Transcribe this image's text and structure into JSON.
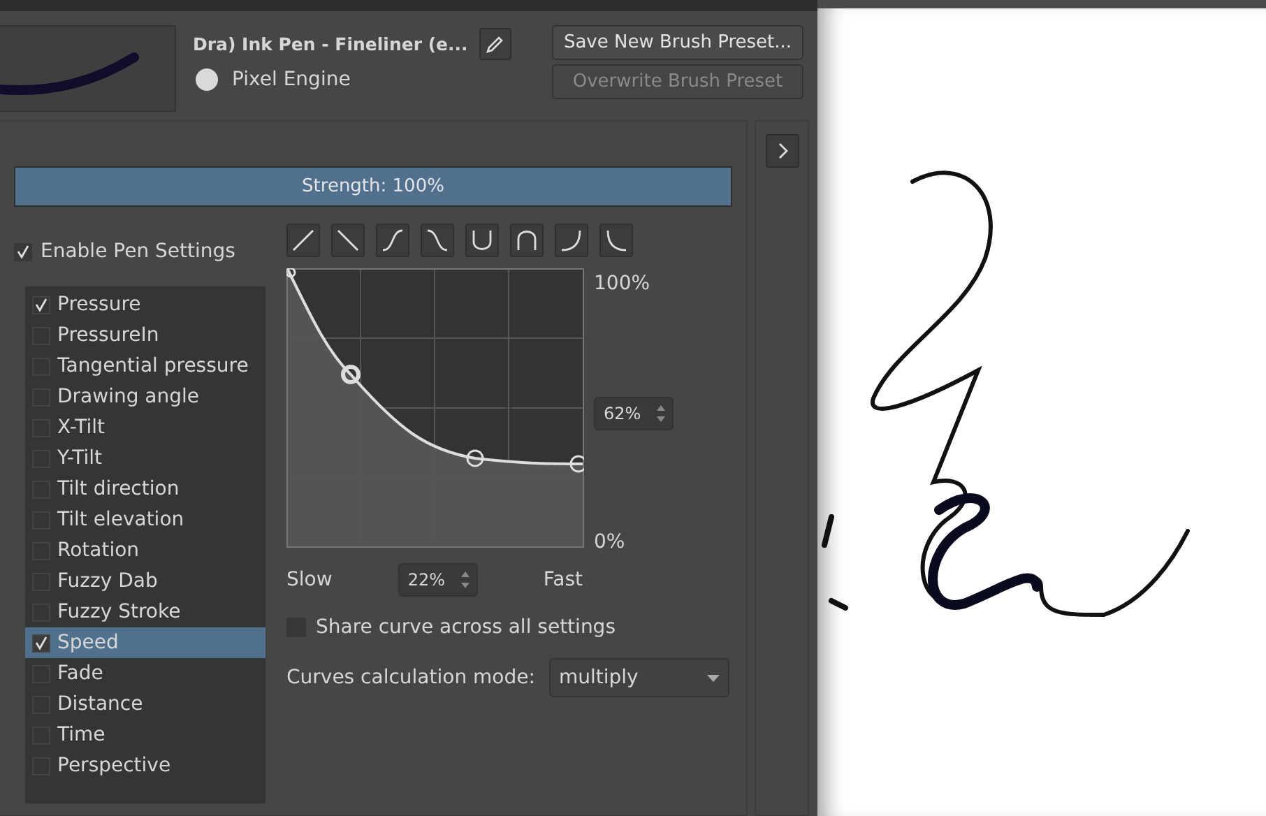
{
  "preset": {
    "name": "Dra) Ink Pen - Fineliner (e...",
    "engine": "Pixel Engine"
  },
  "buttons": [
    {
      "label": "Save New Brush Preset...",
      "disabled": false
    },
    {
      "label": "Overwrite Brush Preset",
      "disabled": true
    }
  ],
  "strength": {
    "label": "Strength: 100%",
    "level": 1
  },
  "enable_pen_settings": {
    "label": "Enable Pen Settings",
    "checked": true
  },
  "sensors": [
    {
      "label": "Pressure",
      "checked": true,
      "selected": false
    },
    {
      "label": "PressureIn",
      "checked": false,
      "selected": false
    },
    {
      "label": "Tangential pressure",
      "checked": false,
      "selected": false
    },
    {
      "label": "Drawing angle",
      "checked": false,
      "selected": false
    },
    {
      "label": "X-Tilt",
      "checked": false,
      "selected": false
    },
    {
      "label": "Y-Tilt",
      "checked": false,
      "selected": false
    },
    {
      "label": "Tilt direction",
      "checked": false,
      "selected": false
    },
    {
      "label": "Tilt elevation",
      "checked": false,
      "selected": false
    },
    {
      "label": "Rotation",
      "checked": false,
      "selected": false
    },
    {
      "label": "Fuzzy Dab",
      "checked": false,
      "selected": false
    },
    {
      "label": "Fuzzy Stroke",
      "checked": false,
      "selected": false
    },
    {
      "label": "Speed",
      "checked": true,
      "selected": true
    },
    {
      "label": "Fade",
      "checked": false,
      "selected": false
    },
    {
      "label": "Distance",
      "checked": false,
      "selected": false
    },
    {
      "label": "Time",
      "checked": false,
      "selected": false
    },
    {
      "label": "Perspective",
      "checked": false,
      "selected": false
    }
  ],
  "curve": {
    "y_max": "100%",
    "y_value": "62%",
    "y_min": "0%",
    "x_min": "Slow",
    "x_value": "22%",
    "x_max": "Fast"
  },
  "share_curve": {
    "label": "Share curve across all settings",
    "checked": false
  },
  "calculation_mode": {
    "label": "Curves calculation mode:",
    "value": "multiply"
  }
}
